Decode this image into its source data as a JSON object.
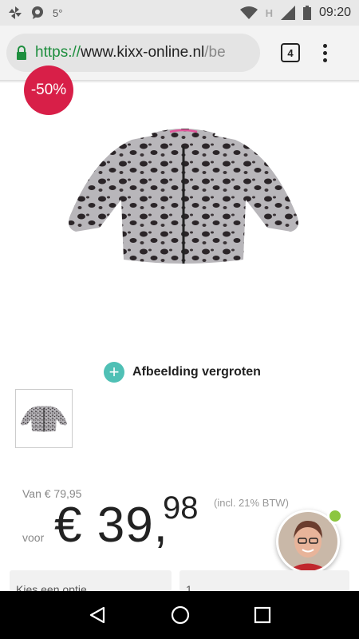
{
  "status_bar": {
    "temperature": "5°",
    "network_letter": "H",
    "time": "09:20"
  },
  "browser": {
    "url_scheme": "https://",
    "url_domain": "www.kixx-online.nl",
    "url_path": "/be",
    "tab_count": "4"
  },
  "product": {
    "sale_badge": "-50%",
    "zoom_label": "Afbeelding vergroten",
    "old_price": "Van € 79,95",
    "voor_label": "voor",
    "price_main": "€ 39,",
    "price_cents": "98",
    "vat_note": "(incl. 21% BTW)"
  },
  "options": {
    "variant_select": "Kies een optie",
    "quantity_select": "1"
  },
  "colors": {
    "sale_red": "#d81f48",
    "accent_teal": "#4fc0b5",
    "online_green": "#8cc63f"
  }
}
